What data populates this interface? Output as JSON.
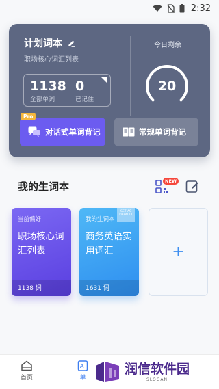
{
  "status_bar": {
    "time": "2:32"
  },
  "plan_card": {
    "title": "计划词本",
    "subtitle": "职场核心词汇列表",
    "stats": [
      {
        "value": "1138",
        "label": "全部单词"
      },
      {
        "value": "0",
        "label": "已记住"
      }
    ],
    "today_label": "今日剩余",
    "today_remaining": "20",
    "dialog_button": "对话式单词背记",
    "pro_badge": "Pro",
    "regular_button": "常规单词背记"
  },
  "my_vocab": {
    "title": "我的生词本",
    "new_badge": "NEW",
    "books": [
      {
        "tag": "当前偏好",
        "name": "职场核心词汇列表",
        "count": "1138 词"
      },
      {
        "tag": "我的生词本",
        "name": "商务英语实用词汇",
        "count": "1631 词",
        "flag": "SET AS DEFAULT"
      }
    ],
    "add_label": "+"
  },
  "bottom_nav": {
    "items": [
      {
        "label": "首页"
      },
      {
        "label": "单"
      }
    ]
  },
  "watermark": {
    "text": "润信软件园",
    "slogan": "SLOGAN"
  },
  "colors": {
    "card_bg": "#5d6782",
    "accent_purple": "#6c5cf0",
    "accent_blue": "#3d7ef0",
    "badge_red": "#f5473c",
    "pro_yellow": "#f6b73c"
  }
}
